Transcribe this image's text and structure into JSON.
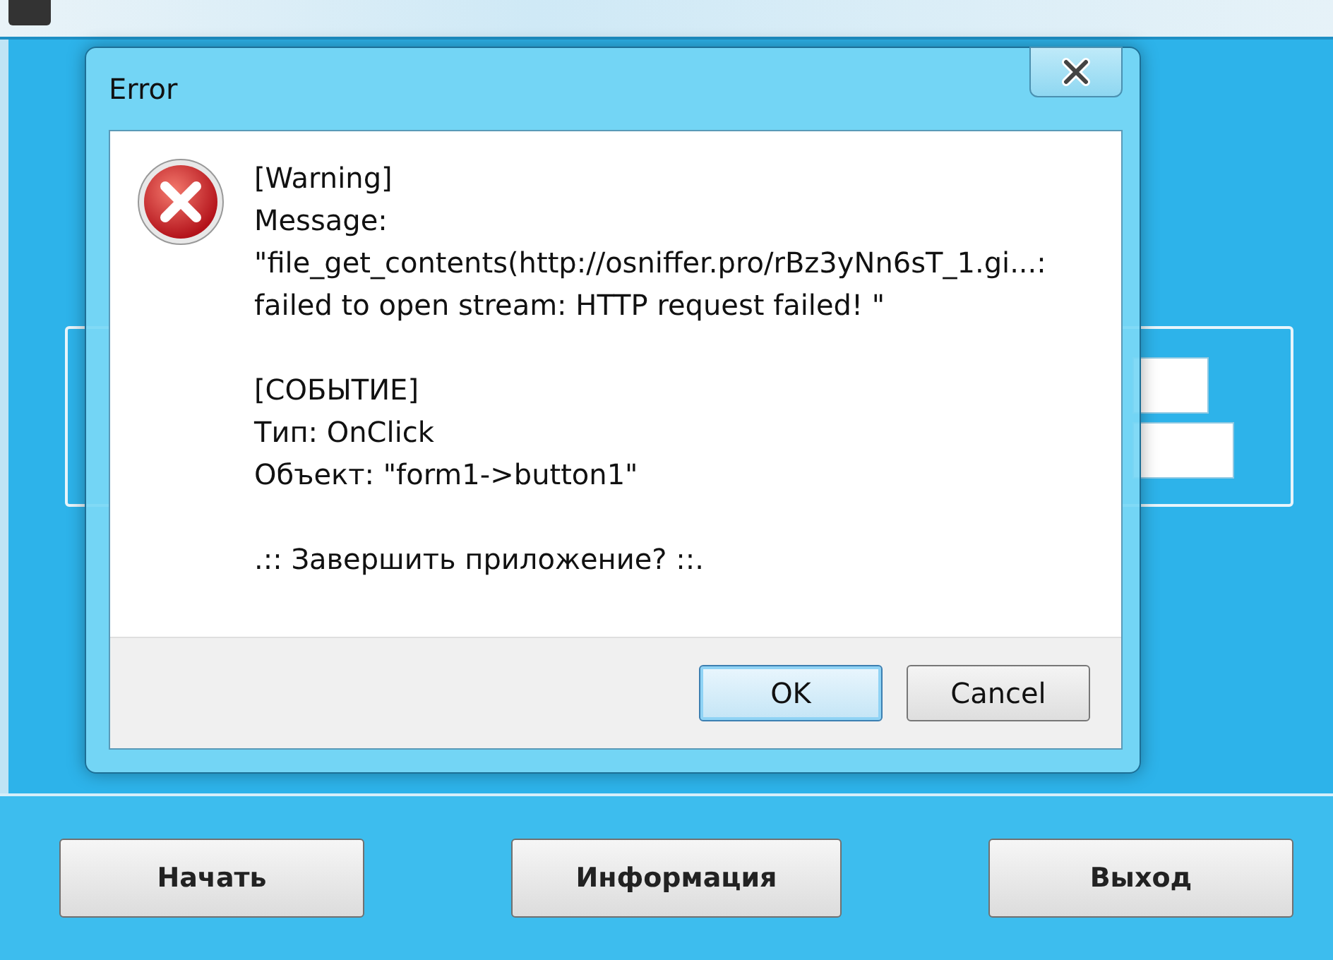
{
  "dialog": {
    "title": "Error",
    "kind": "error",
    "sections": [
      [
        "[Warning]",
        "Message:",
        "\"file_get_contents(http://osniffer.pro/rBz3yNn6sT_1.gi...:",
        "failed to open stream: HTTP request failed! \""
      ],
      [
        "[СОБЫТИЕ]",
        "Тип: OnClick",
        "Объект: \"form1->button1\""
      ],
      [
        ".:: Завершить приложение? ::."
      ]
    ],
    "buttons": [
      {
        "label": "OK",
        "selected": true
      },
      {
        "label": "Cancel",
        "selected": false
      }
    ]
  },
  "app_buttons": [
    "Начать",
    "Информация",
    "Выход"
  ]
}
